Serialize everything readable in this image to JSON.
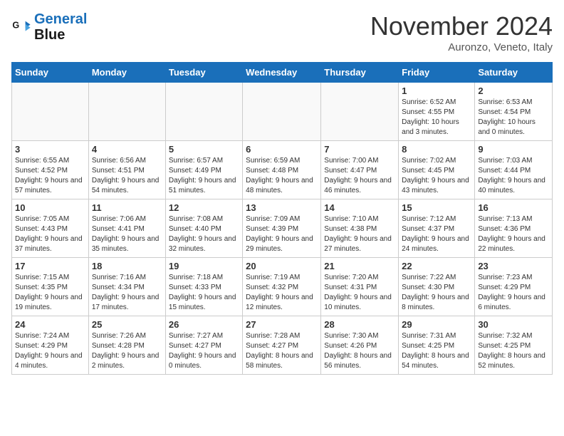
{
  "header": {
    "logo_line1": "General",
    "logo_line2": "Blue",
    "month": "November 2024",
    "location": "Auronzo, Veneto, Italy"
  },
  "days_of_week": [
    "Sunday",
    "Monday",
    "Tuesday",
    "Wednesday",
    "Thursday",
    "Friday",
    "Saturday"
  ],
  "weeks": [
    [
      {
        "day": "",
        "info": ""
      },
      {
        "day": "",
        "info": ""
      },
      {
        "day": "",
        "info": ""
      },
      {
        "day": "",
        "info": ""
      },
      {
        "day": "",
        "info": ""
      },
      {
        "day": "1",
        "info": "Sunrise: 6:52 AM\nSunset: 4:55 PM\nDaylight: 10 hours and 3 minutes."
      },
      {
        "day": "2",
        "info": "Sunrise: 6:53 AM\nSunset: 4:54 PM\nDaylight: 10 hours and 0 minutes."
      }
    ],
    [
      {
        "day": "3",
        "info": "Sunrise: 6:55 AM\nSunset: 4:52 PM\nDaylight: 9 hours and 57 minutes."
      },
      {
        "day": "4",
        "info": "Sunrise: 6:56 AM\nSunset: 4:51 PM\nDaylight: 9 hours and 54 minutes."
      },
      {
        "day": "5",
        "info": "Sunrise: 6:57 AM\nSunset: 4:49 PM\nDaylight: 9 hours and 51 minutes."
      },
      {
        "day": "6",
        "info": "Sunrise: 6:59 AM\nSunset: 4:48 PM\nDaylight: 9 hours and 48 minutes."
      },
      {
        "day": "7",
        "info": "Sunrise: 7:00 AM\nSunset: 4:47 PM\nDaylight: 9 hours and 46 minutes."
      },
      {
        "day": "8",
        "info": "Sunrise: 7:02 AM\nSunset: 4:45 PM\nDaylight: 9 hours and 43 minutes."
      },
      {
        "day": "9",
        "info": "Sunrise: 7:03 AM\nSunset: 4:44 PM\nDaylight: 9 hours and 40 minutes."
      }
    ],
    [
      {
        "day": "10",
        "info": "Sunrise: 7:05 AM\nSunset: 4:43 PM\nDaylight: 9 hours and 37 minutes."
      },
      {
        "day": "11",
        "info": "Sunrise: 7:06 AM\nSunset: 4:41 PM\nDaylight: 9 hours and 35 minutes."
      },
      {
        "day": "12",
        "info": "Sunrise: 7:08 AM\nSunset: 4:40 PM\nDaylight: 9 hours and 32 minutes."
      },
      {
        "day": "13",
        "info": "Sunrise: 7:09 AM\nSunset: 4:39 PM\nDaylight: 9 hours and 29 minutes."
      },
      {
        "day": "14",
        "info": "Sunrise: 7:10 AM\nSunset: 4:38 PM\nDaylight: 9 hours and 27 minutes."
      },
      {
        "day": "15",
        "info": "Sunrise: 7:12 AM\nSunset: 4:37 PM\nDaylight: 9 hours and 24 minutes."
      },
      {
        "day": "16",
        "info": "Sunrise: 7:13 AM\nSunset: 4:36 PM\nDaylight: 9 hours and 22 minutes."
      }
    ],
    [
      {
        "day": "17",
        "info": "Sunrise: 7:15 AM\nSunset: 4:35 PM\nDaylight: 9 hours and 19 minutes."
      },
      {
        "day": "18",
        "info": "Sunrise: 7:16 AM\nSunset: 4:34 PM\nDaylight: 9 hours and 17 minutes."
      },
      {
        "day": "19",
        "info": "Sunrise: 7:18 AM\nSunset: 4:33 PM\nDaylight: 9 hours and 15 minutes."
      },
      {
        "day": "20",
        "info": "Sunrise: 7:19 AM\nSunset: 4:32 PM\nDaylight: 9 hours and 12 minutes."
      },
      {
        "day": "21",
        "info": "Sunrise: 7:20 AM\nSunset: 4:31 PM\nDaylight: 9 hours and 10 minutes."
      },
      {
        "day": "22",
        "info": "Sunrise: 7:22 AM\nSunset: 4:30 PM\nDaylight: 9 hours and 8 minutes."
      },
      {
        "day": "23",
        "info": "Sunrise: 7:23 AM\nSunset: 4:29 PM\nDaylight: 9 hours and 6 minutes."
      }
    ],
    [
      {
        "day": "24",
        "info": "Sunrise: 7:24 AM\nSunset: 4:29 PM\nDaylight: 9 hours and 4 minutes."
      },
      {
        "day": "25",
        "info": "Sunrise: 7:26 AM\nSunset: 4:28 PM\nDaylight: 9 hours and 2 minutes."
      },
      {
        "day": "26",
        "info": "Sunrise: 7:27 AM\nSunset: 4:27 PM\nDaylight: 9 hours and 0 minutes."
      },
      {
        "day": "27",
        "info": "Sunrise: 7:28 AM\nSunset: 4:27 PM\nDaylight: 8 hours and 58 minutes."
      },
      {
        "day": "28",
        "info": "Sunrise: 7:30 AM\nSunset: 4:26 PM\nDaylight: 8 hours and 56 minutes."
      },
      {
        "day": "29",
        "info": "Sunrise: 7:31 AM\nSunset: 4:25 PM\nDaylight: 8 hours and 54 minutes."
      },
      {
        "day": "30",
        "info": "Sunrise: 7:32 AM\nSunset: 4:25 PM\nDaylight: 8 hours and 52 minutes."
      }
    ]
  ]
}
